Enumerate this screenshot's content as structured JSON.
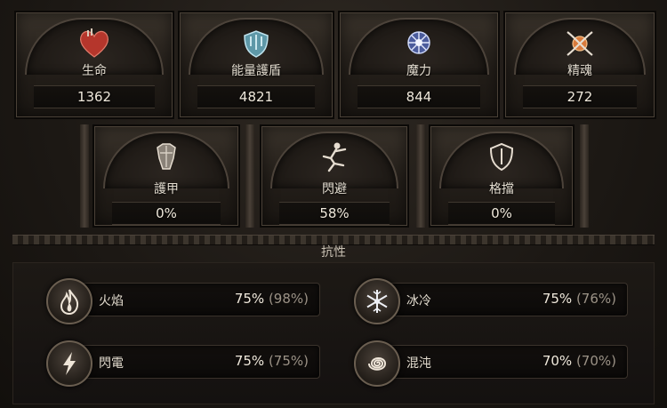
{
  "top_stats": [
    {
      "label": "生命",
      "value": "1362",
      "icon": "heart-icon"
    },
    {
      "label": "能量護盾",
      "value": "4821",
      "icon": "energy-shield-icon"
    },
    {
      "label": "魔力",
      "value": "844",
      "icon": "mana-icon"
    },
    {
      "label": "精魂",
      "value": "272",
      "icon": "spirit-icon"
    }
  ],
  "defence_stats": [
    {
      "label": "護甲",
      "value": "0%",
      "icon": "armour-icon"
    },
    {
      "label": "閃避",
      "value": "58%",
      "icon": "evasion-icon"
    },
    {
      "label": "格擋",
      "value": "0%",
      "icon": "block-icon"
    }
  ],
  "resistances": {
    "title": "抗性",
    "items": [
      {
        "name": "火焰",
        "value": "75%",
        "cap": "(98%)",
        "icon": "fire-icon"
      },
      {
        "name": "冰冷",
        "value": "75%",
        "cap": "(76%)",
        "icon": "cold-icon"
      },
      {
        "name": "閃電",
        "value": "75%",
        "cap": "(75%)",
        "icon": "lightning-icon"
      },
      {
        "name": "混沌",
        "value": "70%",
        "cap": "(70%)",
        "icon": "chaos-icon"
      }
    ]
  },
  "colors": {
    "life": "#c8453a",
    "shield": "#7fb8c9",
    "mana": "#9fb0ea",
    "spirit": "#e08a4a"
  }
}
